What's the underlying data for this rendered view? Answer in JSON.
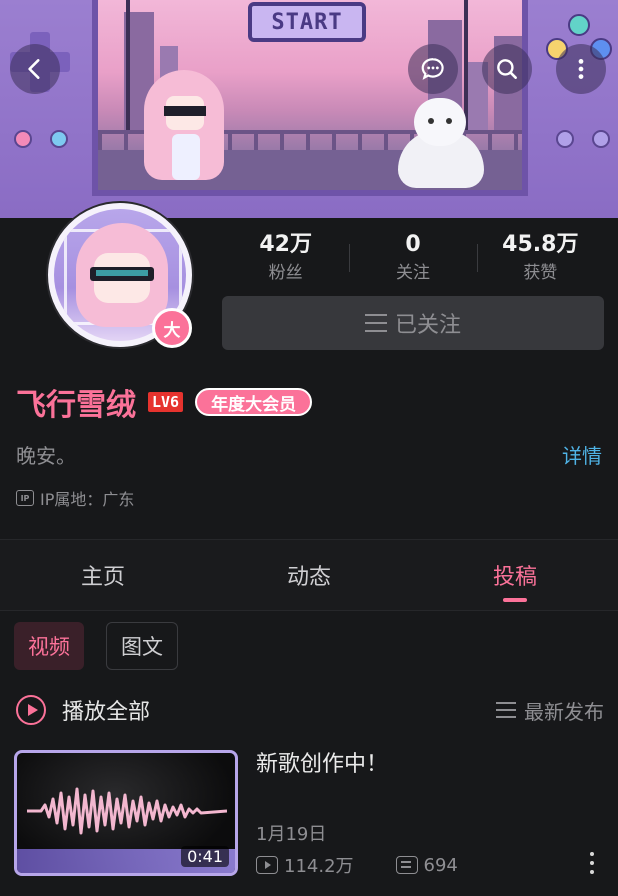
{
  "banner": {
    "start_label": "START",
    "icons": [
      "back-icon",
      "message-icon",
      "search-icon",
      "more-icon"
    ]
  },
  "profile": {
    "avatar_badge": "大",
    "stats": [
      {
        "value": "42万",
        "label": "粉丝"
      },
      {
        "value": "0",
        "label": "关注"
      },
      {
        "value": "45.8万",
        "label": "获赞"
      }
    ],
    "follow_label": "已关注",
    "username": "飞行雪绒",
    "level": "LV6",
    "vip_label": "年度大会员",
    "signature": "晚安。",
    "details_link": "详情",
    "ip_icon_text": "IP",
    "ip_location": "IP属地：广东"
  },
  "tabs": [
    {
      "label": "主页",
      "active": false
    },
    {
      "label": "动态",
      "active": false
    },
    {
      "label": "投稿",
      "active": true
    }
  ],
  "sub_tabs": [
    {
      "label": "视频",
      "active": true
    },
    {
      "label": "图文",
      "active": false
    }
  ],
  "list_header": {
    "play_all": "播放全部",
    "sort_label": "最新发布"
  },
  "videos": [
    {
      "title": "新歌创作中！",
      "duration": "0:41",
      "date": "1月19日",
      "views": "114.2万",
      "danmaku": "694"
    }
  ],
  "colors": {
    "accent": "#fb7299",
    "link": "#4fb3e6",
    "background": "#17181a",
    "level_badge": "#e6332e"
  }
}
